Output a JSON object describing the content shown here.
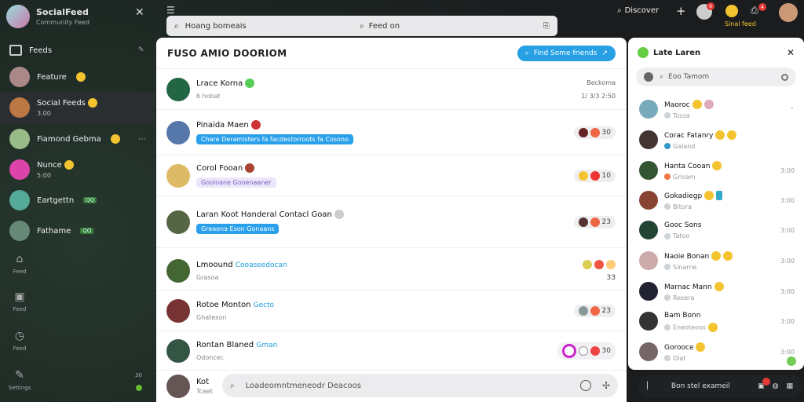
{
  "app": {
    "title": "SocialFeed",
    "subtitle": "Community Feed"
  },
  "sidebar": {
    "items": [
      {
        "label": "Feeds"
      },
      {
        "label": "Feature"
      },
      {
        "label": "Social Feeds",
        "sub": "3.00"
      },
      {
        "label": "Fiamond Gebma"
      },
      {
        "label": "Nunce",
        "sub": "5:00"
      },
      {
        "label": "Eartgettn",
        "tag": "QQ"
      },
      {
        "label": "Fathame",
        "tag": "QQ"
      }
    ],
    "nav": [
      {
        "label": "Feed"
      },
      {
        "label": "Feed"
      },
      {
        "label": "Feed"
      },
      {
        "label": "Settings"
      }
    ],
    "bottom_count": "30"
  },
  "search": {
    "placeholder": "Hoang bomeais",
    "mid": "Feed on"
  },
  "topbar": {
    "discover": "Discover",
    "user_label": "Sinal feed",
    "badge1": "9",
    "badge2": "4"
  },
  "main": {
    "title": "FUSO AMIO DOORIOM",
    "pill": "Find Some friends",
    "rows": [
      {
        "name": "Lrace Korna",
        "sub": "6 hobat",
        "time1": "Beckoma",
        "time2": "1/ 3/3 2:50"
      },
      {
        "name": "Pinaida Maen",
        "bubble": "Chare Deramisters fa facdestorroots fa Cosono",
        "count": "30"
      },
      {
        "name": "Corol Fooan",
        "bubble": "Gooloane Gooenaaner",
        "count": "10"
      },
      {
        "name": "Laran Koot Handeral Contacl Goan",
        "bubble": "Greaona Eson Gonaans",
        "count": "23"
      },
      {
        "name": "Lmoound",
        "link": "Cooaseedocan",
        "sub": "Grasoa",
        "count": "33"
      },
      {
        "name": "Rotoe Monton",
        "link": "Gecto",
        "sub": "Ghateson",
        "count": "23"
      },
      {
        "name": "Rontan Blaned",
        "link": "Gman",
        "sub": "Odoncec",
        "count": "30"
      },
      {
        "name": "Kot",
        "sub": "Tcaet"
      }
    ],
    "compose_placeholder": "Loadeomntmeneodr Deacoos"
  },
  "right_panel": {
    "title": "Late Laren",
    "search_placeholder": "Eoo Tamom",
    "items": [
      {
        "name": "Maoroc",
        "sub": "Tossa"
      },
      {
        "name": "Corac Fatanry",
        "sub": "Galand"
      },
      {
        "name": "Hanta Cooan",
        "sub": "Grisam",
        "time": "3:00"
      },
      {
        "name": "Gokadiegp",
        "sub": "Bitora",
        "time": "3:00"
      },
      {
        "name": "Gooc Sons",
        "sub": "Tatoo",
        "time": "3:00"
      },
      {
        "name": "Naoie Bonan",
        "sub": "Sinarne",
        "time": "3:00"
      },
      {
        "name": "Marnac Mann",
        "sub": "Resera",
        "time": "3:00"
      },
      {
        "name": "Bam Bonn",
        "sub": "Eneoteoos",
        "time": "3:00"
      },
      {
        "name": "Gorooce",
        "sub": "Dlat",
        "time": "3:00"
      }
    ],
    "bottom_label": "Bon stel exameil"
  }
}
